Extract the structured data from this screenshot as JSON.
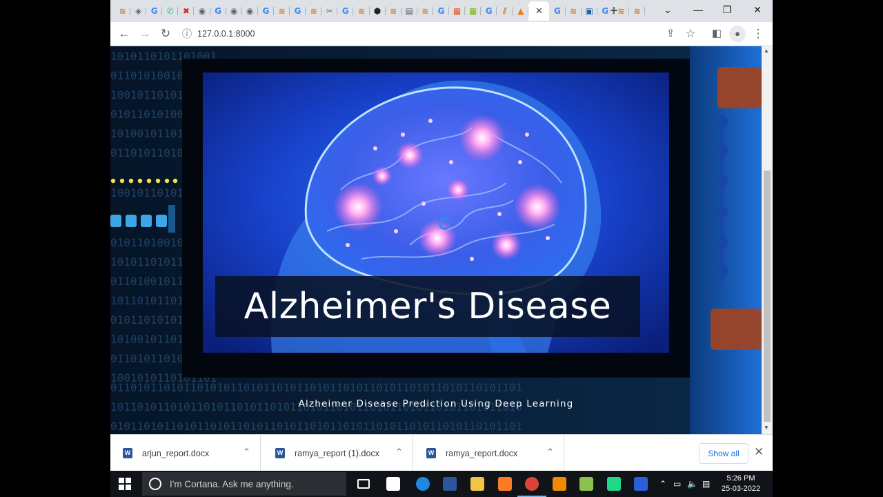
{
  "browser": {
    "address_bar": {
      "url": "127.0.0.1:8000"
    },
    "tabs": [
      {
        "icon": "tab-icon-1",
        "color": "#f07a1a",
        "glyph": "≋"
      },
      {
        "icon": "tab-icon-2",
        "color": "#5f6368",
        "glyph": "◈"
      },
      {
        "icon": "google-icon",
        "color": "#4285f4",
        "glyph": "G"
      },
      {
        "icon": "whatsapp-icon",
        "color": "#25d366",
        "glyph": "✆"
      },
      {
        "icon": "tab-icon-5",
        "color": "#e02020",
        "glyph": "✖"
      },
      {
        "icon": "globe-icon",
        "color": "#5f6368",
        "glyph": "◉"
      },
      {
        "icon": "google-icon",
        "color": "#4285f4",
        "glyph": "G"
      },
      {
        "icon": "globe-icon",
        "color": "#5f6368",
        "glyph": "◉"
      },
      {
        "icon": "globe-icon",
        "color": "#5f6368",
        "glyph": "◉"
      },
      {
        "icon": "google-icon",
        "color": "#4285f4",
        "glyph": "G"
      },
      {
        "icon": "tab-icon-11",
        "color": "#f07a1a",
        "glyph": "≋"
      },
      {
        "icon": "google-icon",
        "color": "#4285f4",
        "glyph": "G"
      },
      {
        "icon": "tab-icon-13",
        "color": "#f07a1a",
        "glyph": "≋"
      },
      {
        "icon": "tab-icon-14",
        "color": "#3a9a3a",
        "glyph": "✂"
      },
      {
        "icon": "google-icon",
        "color": "#4285f4",
        "glyph": "G"
      },
      {
        "icon": "tab-icon-16",
        "color": "#f07a1a",
        "glyph": "≋"
      },
      {
        "icon": "tab-icon-17",
        "color": "#202124",
        "glyph": "⬢"
      },
      {
        "icon": "tab-icon-18",
        "color": "#f07a1a",
        "glyph": "≋"
      },
      {
        "icon": "tab-icon-19",
        "color": "#5f6368",
        "glyph": "▤"
      },
      {
        "icon": "tab-icon-20",
        "color": "#f07a1a",
        "glyph": "≋"
      },
      {
        "icon": "google-icon",
        "color": "#4285f4",
        "glyph": "G"
      },
      {
        "icon": "microsoft-icon",
        "color": "#f25022",
        "glyph": "▦"
      },
      {
        "icon": "microsoft-icon",
        "color": "#7fba00",
        "glyph": "▦"
      },
      {
        "icon": "google-icon",
        "color": "#4285f4",
        "glyph": "G"
      },
      {
        "icon": "tab-icon-25",
        "color": "#e8710a",
        "glyph": "⫽"
      },
      {
        "icon": "tab-icon-26",
        "color": "#f07a1a",
        "glyph": "▲"
      }
    ],
    "active_tab_close": "✕",
    "tabs_after": [
      {
        "icon": "google-icon",
        "color": "#4285f4",
        "glyph": "G"
      },
      {
        "icon": "tab-icon-28",
        "color": "#f07a1a",
        "glyph": "≋"
      },
      {
        "icon": "tab-icon-29",
        "color": "#1f5fa8",
        "glyph": "▣"
      },
      {
        "icon": "google-icon",
        "color": "#4285f4",
        "glyph": "G"
      },
      {
        "icon": "tab-icon-31",
        "color": "#f07a1a",
        "glyph": "≋"
      },
      {
        "icon": "tab-icon-32",
        "color": "#f07a1a",
        "glyph": "≋"
      }
    ],
    "new_tab": "+",
    "window_controls": {
      "menu": "⌄",
      "minimize": "—",
      "restore": "❐",
      "close": "✕"
    },
    "toolbar_icons": {
      "back": "←",
      "forward": "→",
      "reload": "↻",
      "info": "ⓘ",
      "share": "⇪",
      "bookmark": "☆",
      "sidepanel": "◧",
      "profile": "●",
      "menu": "⋮"
    }
  },
  "page": {
    "hero_title": "Alzheimer's Disease",
    "subtitle": "Alzheimer Disease Prediction Using Deep Learning"
  },
  "downloads": {
    "items": [
      {
        "name": "arjun_report.docx"
      },
      {
        "name": "ramya_report (1).docx"
      },
      {
        "name": "ramya_report.docx"
      }
    ],
    "chevron": "⌃",
    "show_all": "Show all",
    "close": "✕"
  },
  "taskbar": {
    "cortana_placeholder": "I'm Cortana. Ask me anything.",
    "apps": [
      {
        "name": "task-view-icon",
        "color": "#ffffff"
      },
      {
        "name": "store-icon",
        "color": "#ffffff"
      },
      {
        "name": "edge-icon",
        "color": "#1e88e5"
      },
      {
        "name": "word-icon",
        "color": "#2b579a"
      },
      {
        "name": "file-explorer-icon",
        "color": "#f3c344"
      },
      {
        "name": "xampp-icon",
        "color": "#fb7a24"
      },
      {
        "name": "chrome-icon",
        "color": "#db4437"
      },
      {
        "name": "vlc-icon",
        "color": "#f08a00"
      },
      {
        "name": "notepadpp-icon",
        "color": "#8bc34a"
      },
      {
        "name": "pycharm-icon",
        "color": "#21d789"
      },
      {
        "name": "app-icon",
        "color": "#2b5fd9"
      }
    ],
    "tray_icons": {
      "chevron": "⌃",
      "network": "▭",
      "volume": "🔈",
      "notifications": "▤"
    },
    "time": "5:26 PM",
    "date": "25-03-2022"
  }
}
